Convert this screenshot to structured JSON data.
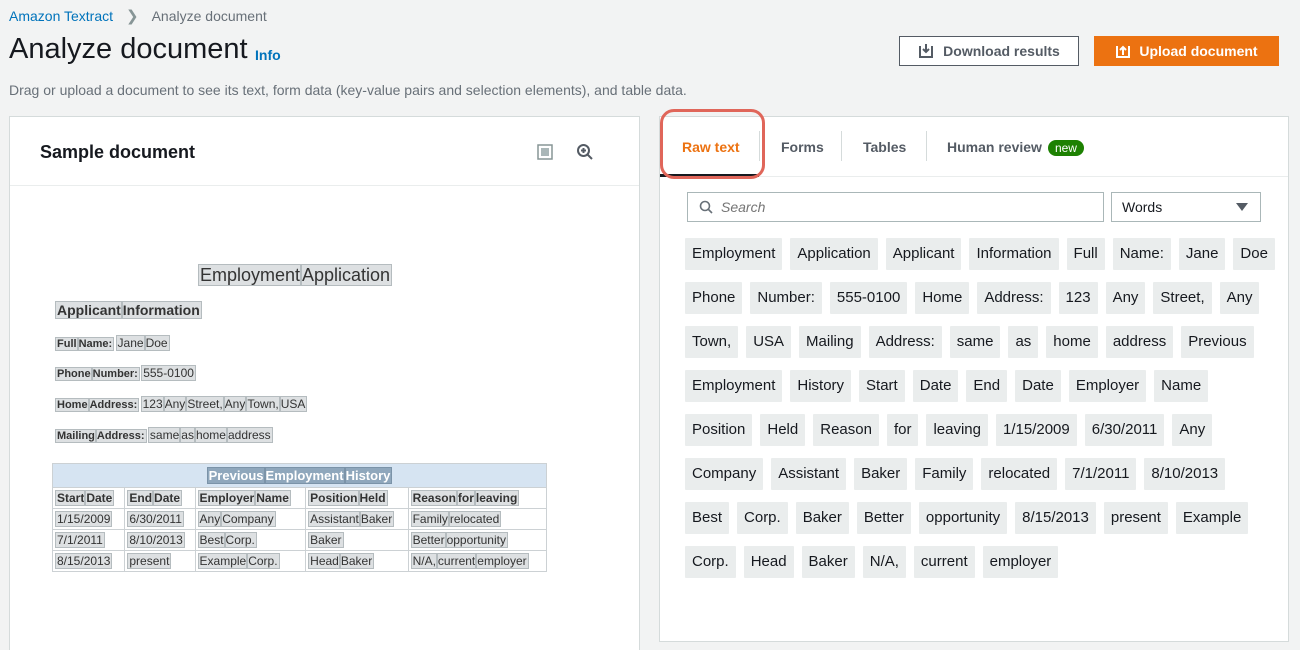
{
  "breadcrumb": {
    "root": "Amazon Textract",
    "current": "Analyze document"
  },
  "header": {
    "title": "Analyze document",
    "info": "Info",
    "description": "Drag or upload a document to see its text, form data (key-value pairs and selection elements), and table data.",
    "download_label": "Download results",
    "upload_label": "Upload document"
  },
  "left_panel": {
    "title": "Sample document",
    "doc": {
      "title_words": [
        "Employment",
        "Application"
      ],
      "heading_words": [
        "Applicant",
        "Information"
      ],
      "lines": [
        {
          "label": [
            "Full",
            "Name:"
          ],
          "words": [
            "Jane",
            "Doe"
          ]
        },
        {
          "label": [
            "Phone",
            "Number:"
          ],
          "words": [
            "555-0100"
          ]
        },
        {
          "label": [
            "Home",
            "Address:"
          ],
          "words": [
            "123",
            "Any",
            "Street,",
            "Any",
            "Town,",
            "USA"
          ]
        },
        {
          "label": [
            "Mailing",
            "Address:"
          ],
          "words": [
            "same",
            "as",
            "home",
            "address"
          ]
        }
      ],
      "table_caption": [
        "Previous",
        "Employment",
        "History"
      ],
      "table_headers": [
        [
          "Start",
          "Date"
        ],
        [
          "End",
          "Date"
        ],
        [
          "Employer",
          "Name"
        ],
        [
          "Position",
          "Held"
        ],
        [
          "Reason",
          "for",
          "leaving"
        ]
      ],
      "table_rows": [
        [
          [
            "1/15/2009"
          ],
          [
            "6/30/2011"
          ],
          [
            "Any",
            "Company"
          ],
          [
            "Assistant",
            "Baker"
          ],
          [
            "Family",
            "relocated"
          ]
        ],
        [
          [
            "7/1/2011"
          ],
          [
            "8/10/2013"
          ],
          [
            "Best",
            "Corp."
          ],
          [
            "Baker"
          ],
          [
            "Better",
            "opportunity"
          ]
        ],
        [
          [
            "8/15/2013"
          ],
          [
            "present"
          ],
          [
            "Example",
            "Corp."
          ],
          [
            "Head",
            "Baker"
          ],
          [
            "N/A,",
            "current",
            "employer"
          ]
        ]
      ]
    }
  },
  "right_panel": {
    "tabs": [
      {
        "label": "Raw text",
        "active": true
      },
      {
        "label": "Forms"
      },
      {
        "label": "Tables"
      },
      {
        "label": "Human review",
        "badge": "new"
      }
    ],
    "search_placeholder": "Search",
    "select_value": "Words",
    "words": [
      "Employment",
      "Application",
      "Applicant",
      "Information",
      "Full",
      "Name:",
      "Jane",
      "Doe",
      "Phone",
      "Number:",
      "555-0100",
      "Home",
      "Address:",
      "123",
      "Any",
      "Street,",
      "Any",
      "Town,",
      "USA",
      "Mailing",
      "Address:",
      "same",
      "as",
      "home",
      "address",
      "Previous",
      "Employment",
      "History",
      "Start",
      "Date",
      "End",
      "Date",
      "Employer",
      "Name",
      "Position",
      "Held",
      "Reason",
      "for",
      "leaving",
      "1/15/2009",
      "6/30/2011",
      "Any",
      "Company",
      "Assistant",
      "Baker",
      "Family",
      "relocated",
      "7/1/2011",
      "8/10/2013",
      "Best",
      "Corp.",
      "Baker",
      "Better",
      "opportunity",
      "8/15/2013",
      "present",
      "Example",
      "Corp.",
      "Head",
      "Baker",
      "N/A,",
      "current",
      "employer"
    ]
  },
  "colors": {
    "accent": "#ec7211",
    "link": "#0073bb",
    "badge": "#1d8102",
    "highlight": "#e0665a"
  },
  "icons": {
    "download": "download-icon",
    "upload": "upload-icon",
    "view": "document-view-icon",
    "zoom": "zoom-in-icon",
    "search": "search-icon",
    "caret": "caret-down-icon"
  }
}
